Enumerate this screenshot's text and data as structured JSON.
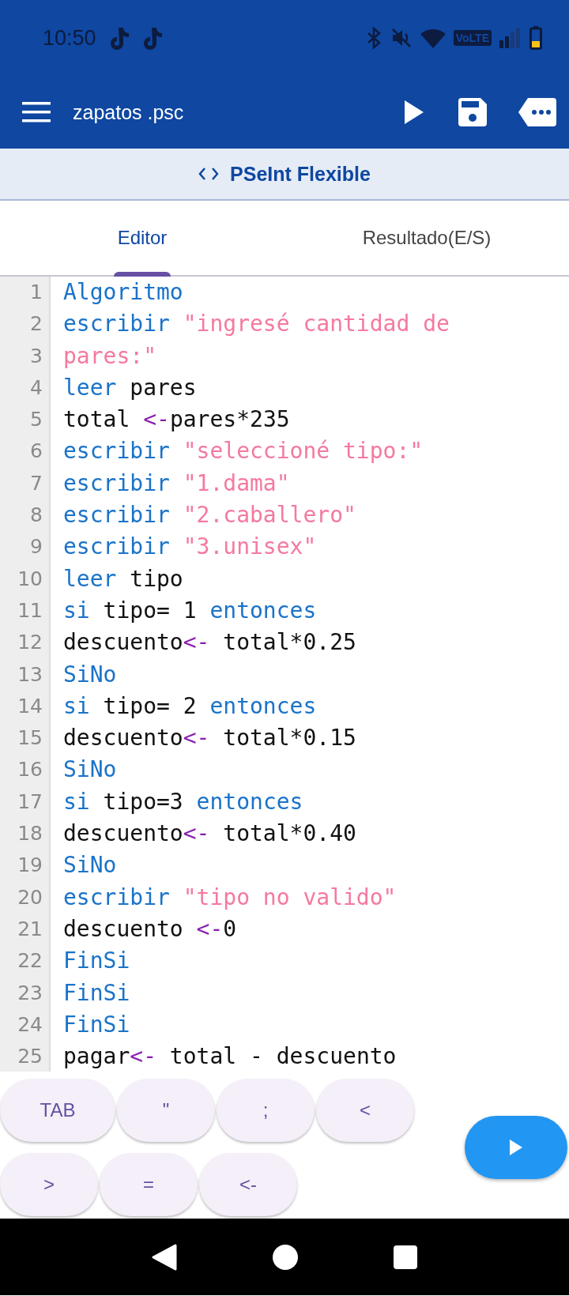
{
  "status_bar": {
    "time": "10:50",
    "network_label": "VoLTE"
  },
  "app_bar": {
    "title": "zapatos .psc"
  },
  "mode_banner": {
    "label": "PSeInt Flexible"
  },
  "tabs": [
    {
      "label": "Editor",
      "selected": true
    },
    {
      "label": "Resultado(E/S)",
      "selected": false
    }
  ],
  "editor": {
    "lines": [
      {
        "number": "1",
        "tokens": [
          {
            "kind": "kw",
            "text": "Algoritmo"
          }
        ]
      },
      {
        "number": "2",
        "tokens": [
          {
            "kind": "kw",
            "text": "escribir "
          },
          {
            "kind": "str",
            "text": "\"ingresé cantidad de"
          }
        ]
      },
      {
        "number": "3",
        "tokens": [
          {
            "kind": "str",
            "text": "pares:\""
          }
        ]
      },
      {
        "number": "4",
        "tokens": [
          {
            "kind": "kw",
            "text": "leer "
          },
          {
            "kind": "plain",
            "text": "pares"
          }
        ]
      },
      {
        "number": "5",
        "tokens": [
          {
            "kind": "plain",
            "text": "total "
          },
          {
            "kind": "op",
            "text": "<-"
          },
          {
            "kind": "plain",
            "text": "pares*235"
          }
        ]
      },
      {
        "number": "6",
        "tokens": [
          {
            "kind": "kw",
            "text": "escribir "
          },
          {
            "kind": "str",
            "text": "\"seleccioné tipo:\""
          }
        ]
      },
      {
        "number": "7",
        "tokens": [
          {
            "kind": "kw",
            "text": "escribir "
          },
          {
            "kind": "str",
            "text": "\"1.dama\""
          }
        ]
      },
      {
        "number": "8",
        "tokens": [
          {
            "kind": "kw",
            "text": "escribir "
          },
          {
            "kind": "str",
            "text": "\"2.caballero\""
          }
        ]
      },
      {
        "number": "9",
        "tokens": [
          {
            "kind": "kw",
            "text": "escribir "
          },
          {
            "kind": "str",
            "text": "\"3.unisex\""
          }
        ]
      },
      {
        "number": "10",
        "tokens": [
          {
            "kind": "kw",
            "text": "leer "
          },
          {
            "kind": "plain",
            "text": "tipo"
          }
        ]
      },
      {
        "number": "11",
        "tokens": [
          {
            "kind": "kw",
            "text": "si "
          },
          {
            "kind": "plain",
            "text": "tipo= 1 "
          },
          {
            "kind": "kw",
            "text": "entonces"
          }
        ]
      },
      {
        "number": "12",
        "tokens": [
          {
            "kind": "plain",
            "text": "descuento"
          },
          {
            "kind": "op",
            "text": "<-"
          },
          {
            "kind": "plain",
            "text": " total*0.25"
          }
        ]
      },
      {
        "number": "13",
        "tokens": [
          {
            "kind": "kw",
            "text": "SiNo"
          }
        ]
      },
      {
        "number": "14",
        "tokens": [
          {
            "kind": "kw",
            "text": "si "
          },
          {
            "kind": "plain",
            "text": "tipo= 2 "
          },
          {
            "kind": "kw",
            "text": "entonces"
          }
        ]
      },
      {
        "number": "15",
        "tokens": [
          {
            "kind": "plain",
            "text": "descuento"
          },
          {
            "kind": "op",
            "text": "<-"
          },
          {
            "kind": "plain",
            "text": " total*0.15"
          }
        ]
      },
      {
        "number": "16",
        "tokens": [
          {
            "kind": "kw",
            "text": "SiNo"
          }
        ]
      },
      {
        "number": "17",
        "tokens": [
          {
            "kind": "kw",
            "text": "si "
          },
          {
            "kind": "plain",
            "text": "tipo=3 "
          },
          {
            "kind": "kw",
            "text": "entonces"
          }
        ]
      },
      {
        "number": "18",
        "tokens": [
          {
            "kind": "plain",
            "text": "descuento"
          },
          {
            "kind": "op",
            "text": "<-"
          },
          {
            "kind": "plain",
            "text": " total*0.40"
          }
        ]
      },
      {
        "number": "19",
        "tokens": [
          {
            "kind": "kw",
            "text": "SiNo"
          }
        ]
      },
      {
        "number": "20",
        "tokens": [
          {
            "kind": "kw",
            "text": "escribir "
          },
          {
            "kind": "str",
            "text": "\"tipo no valido\""
          }
        ]
      },
      {
        "number": "21",
        "tokens": [
          {
            "kind": "plain",
            "text": "descuento "
          },
          {
            "kind": "op",
            "text": "<-"
          },
          {
            "kind": "plain",
            "text": "0"
          }
        ]
      },
      {
        "number": "22",
        "tokens": [
          {
            "kind": "kw",
            "text": "FinSi"
          }
        ]
      },
      {
        "number": "23",
        "tokens": [
          {
            "kind": "kw",
            "text": "FinSi"
          }
        ]
      },
      {
        "number": "24",
        "tokens": [
          {
            "kind": "kw",
            "text": "FinSi"
          }
        ]
      },
      {
        "number": "25",
        "tokens": [
          {
            "kind": "plain",
            "text": "pagar"
          },
          {
            "kind": "op",
            "text": "<-"
          },
          {
            "kind": "plain",
            "text": " total - descuento"
          }
        ]
      }
    ]
  },
  "key_rows": [
    [
      "TAB",
      "\"",
      ";",
      "<"
    ],
    [
      ">",
      "=",
      "<-"
    ]
  ]
}
